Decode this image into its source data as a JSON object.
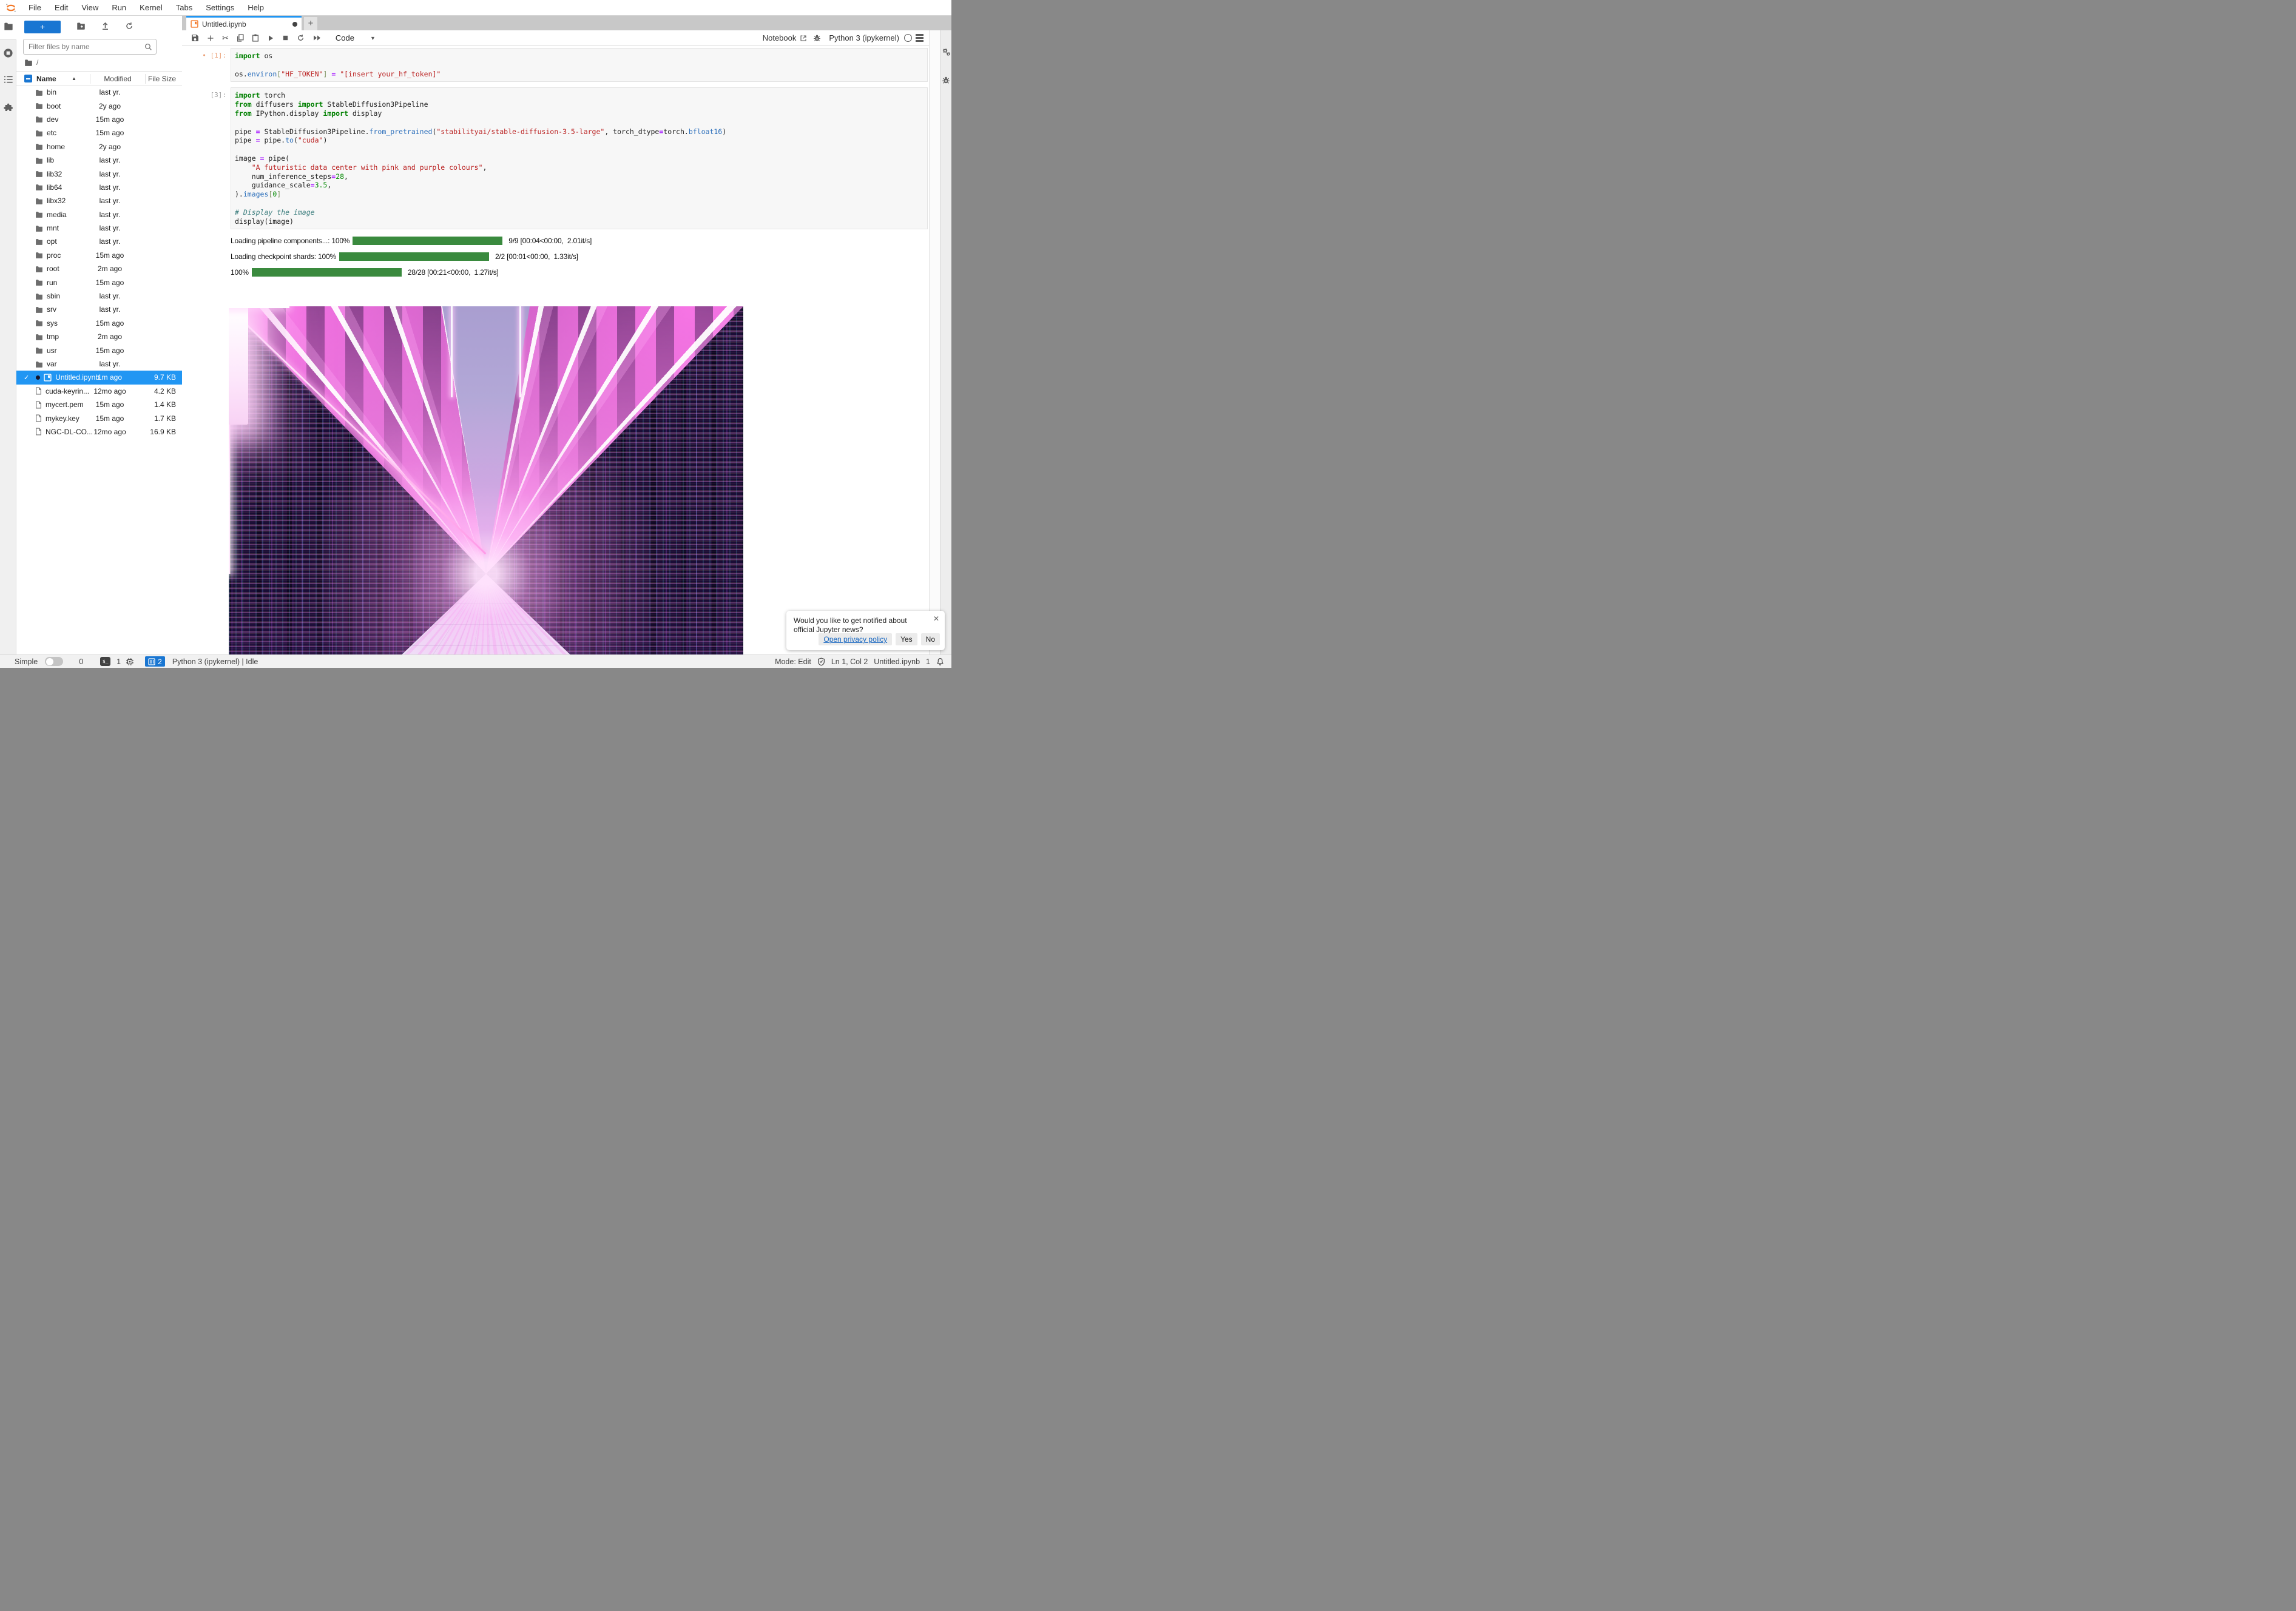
{
  "menu_bar": {
    "items": [
      "File",
      "Edit",
      "View",
      "Run",
      "Kernel",
      "Tabs",
      "Settings",
      "Help"
    ]
  },
  "file_browser": {
    "new_launcher_label": "+",
    "filter_placeholder": "Filter files by name",
    "breadcrumb_root": "/",
    "columns": {
      "name": "Name",
      "modified": "Modified",
      "size": "File Size",
      "sort_indicator": "▲"
    },
    "folders": [
      {
        "name": "bin",
        "modified": "last yr."
      },
      {
        "name": "boot",
        "modified": "2y ago"
      },
      {
        "name": "dev",
        "modified": "15m ago"
      },
      {
        "name": "etc",
        "modified": "15m ago"
      },
      {
        "name": "home",
        "modified": "2y ago"
      },
      {
        "name": "lib",
        "modified": "last yr."
      },
      {
        "name": "lib32",
        "modified": "last yr."
      },
      {
        "name": "lib64",
        "modified": "last yr."
      },
      {
        "name": "libx32",
        "modified": "last yr."
      },
      {
        "name": "media",
        "modified": "last yr."
      },
      {
        "name": "mnt",
        "modified": "last yr."
      },
      {
        "name": "opt",
        "modified": "last yr."
      },
      {
        "name": "proc",
        "modified": "15m ago"
      },
      {
        "name": "root",
        "modified": "2m ago"
      },
      {
        "name": "run",
        "modified": "15m ago"
      },
      {
        "name": "sbin",
        "modified": "last yr."
      },
      {
        "name": "srv",
        "modified": "last yr."
      },
      {
        "name": "sys",
        "modified": "15m ago"
      },
      {
        "name": "tmp",
        "modified": "2m ago"
      },
      {
        "name": "usr",
        "modified": "15m ago"
      },
      {
        "name": "var",
        "modified": "last yr."
      }
    ],
    "files": [
      {
        "name": "Untitled.ipynb",
        "modified": "1m ago",
        "size": "9.7 KB",
        "icon": "notebook",
        "selected": true,
        "check": "✓"
      },
      {
        "name": "cuda-keyrin...",
        "modified": "12mo ago",
        "size": "4.2 KB",
        "icon": "doc"
      },
      {
        "name": "mycert.pem",
        "modified": "15m ago",
        "size": "1.4 KB",
        "icon": "doc"
      },
      {
        "name": "mykey.key",
        "modified": "15m ago",
        "size": "1.7 KB",
        "icon": "doc"
      },
      {
        "name": "NGC-DL-CO...",
        "modified": "12mo ago",
        "size": "16.9 KB",
        "icon": "doc"
      }
    ]
  },
  "dock": {
    "tab_title": "Untitled.ipynb",
    "add_tab_label": "+",
    "toolbar": {
      "cell_type": "Code",
      "notebook_label": "Notebook",
      "kernel_name": "Python 3 (ipykernel)"
    }
  },
  "notebook": {
    "cells": [
      {
        "prompt": "[1]:",
        "bullet": "•",
        "state": "active",
        "lines": [
          [
            [
              "kw",
              "import"
            ],
            [
              "t",
              " os"
            ]
          ],
          [],
          [
            [
              "t",
              "os."
            ],
            [
              "fn",
              "environ"
            ],
            [
              "br",
              "["
            ],
            [
              "st",
              "\"HF_TOKEN\""
            ],
            [
              "br",
              "]"
            ],
            [
              "t",
              " "
            ],
            [
              "op",
              "="
            ],
            [
              "t",
              " "
            ],
            [
              "st",
              "\"[insert your_hf_token]\""
            ]
          ]
        ]
      },
      {
        "prompt": "[3]:",
        "bullet": "",
        "state": "idle",
        "lines": [
          [
            [
              "kw",
              "import"
            ],
            [
              "t",
              " torch"
            ]
          ],
          [
            [
              "kw",
              "from"
            ],
            [
              "t",
              " diffusers "
            ],
            [
              "kw",
              "import"
            ],
            [
              "t",
              " StableDiffusion3Pipeline"
            ]
          ],
          [
            [
              "kw",
              "from"
            ],
            [
              "t",
              " IPython.display "
            ],
            [
              "kw",
              "import"
            ],
            [
              "t",
              " display"
            ]
          ],
          [],
          [
            [
              "t",
              "pipe "
            ],
            [
              "op",
              "="
            ],
            [
              "t",
              " StableDiffusion3Pipeline."
            ],
            [
              "fn",
              "from_pretrained"
            ],
            [
              "t",
              "("
            ],
            [
              "st",
              "\"stabilityai/stable-diffusion-3.5-large\""
            ],
            [
              "t",
              ", torch_dtype"
            ],
            [
              "op",
              "="
            ],
            [
              "t",
              "torch."
            ],
            [
              "fn",
              "bfloat16"
            ],
            [
              "t",
              ")"
            ]
          ],
          [
            [
              "t",
              "pipe "
            ],
            [
              "op",
              "="
            ],
            [
              "t",
              " pipe."
            ],
            [
              "fn",
              "to"
            ],
            [
              "t",
              "("
            ],
            [
              "st",
              "\"cuda\""
            ],
            [
              "t",
              ")"
            ]
          ],
          [],
          [
            [
              "t",
              "image "
            ],
            [
              "op",
              "="
            ],
            [
              "t",
              " pipe("
            ]
          ],
          [
            [
              "t",
              "    "
            ],
            [
              "st",
              "\"A futuristic data center with pink and purple colours\""
            ],
            [
              "t",
              ","
            ]
          ],
          [
            [
              "t",
              "    num_inference_steps"
            ],
            [
              "op",
              "="
            ],
            [
              "nu",
              "28"
            ],
            [
              "t",
              ","
            ]
          ],
          [
            [
              "t",
              "    guidance_scale"
            ],
            [
              "op",
              "="
            ],
            [
              "nu",
              "3.5"
            ],
            [
              "t",
              ","
            ]
          ],
          [
            [
              "t",
              ")."
            ],
            [
              "fn",
              "images"
            ],
            [
              "br",
              "["
            ],
            [
              "nu",
              "0"
            ],
            [
              "br",
              "]"
            ]
          ],
          [],
          [
            [
              "cm",
              "# Display the image"
            ]
          ],
          [
            [
              "t",
              "display(image)"
            ]
          ]
        ]
      }
    ],
    "progress_outputs": [
      {
        "label": "Loading pipeline components...:",
        "percent": "100%",
        "meta": "9/9 [00:04<00:00,  2.01it/s]"
      },
      {
        "label": "Loading checkpoint shards:",
        "percent": "100%",
        "meta": "2/2 [00:01<00:00,  1.33it/s]"
      },
      {
        "label": "",
        "percent": "100%",
        "meta": "28/28 [00:21<00:00,  1.27it/s]"
      }
    ],
    "image_output_alt": "Generated image: futuristic data center corridor with pink and purple neon lighting"
  },
  "status_bar": {
    "simple_label": "Simple",
    "terminal_count": "0",
    "kernel_count": "1",
    "notebook_count": "2",
    "kernel_status": "Python 3 (ipykernel) | Idle",
    "mode": "Mode: Edit",
    "cursor_position": "Ln 1, Col 2",
    "filename": "Untitled.ipynb",
    "notification_count": "1"
  },
  "notification": {
    "message": "Would you like to get notified about official Jupyter news?",
    "close_label": "✕",
    "privacy_label": "Open privacy policy",
    "yes_label": "Yes",
    "no_label": "No"
  },
  "colors": {
    "accent_blue": "#1976d2",
    "selection_blue": "#2196f3",
    "tab_accent": "#2196f3",
    "progress_green": "#3a8a3e",
    "logo_orange": "#f37726"
  }
}
